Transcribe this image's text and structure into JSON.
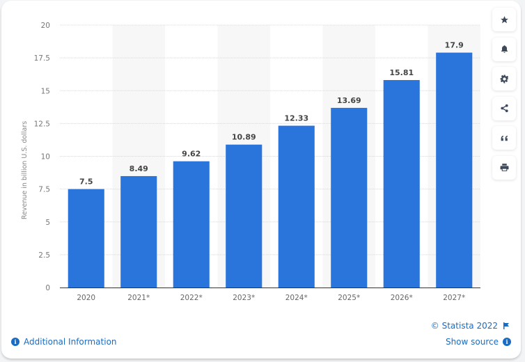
{
  "chart_data": {
    "type": "bar",
    "title": "",
    "xlabel": "",
    "ylabel": "Revenue in billion U.S. dollars",
    "categories": [
      "2020",
      "2021*",
      "2022*",
      "2023*",
      "2024*",
      "2025*",
      "2026*",
      "2027*"
    ],
    "values": [
      7.5,
      8.49,
      9.62,
      10.89,
      12.33,
      13.69,
      15.81,
      17.9
    ],
    "value_labels": [
      "7.5",
      "8.49",
      "9.62",
      "10.89",
      "12.33",
      "13.69",
      "15.81",
      "17.9"
    ],
    "ylim": [
      0,
      20
    ],
    "yticks": [
      0,
      2.5,
      5,
      7.5,
      10,
      12.5,
      15,
      17.5,
      20
    ],
    "ytick_labels": [
      "0",
      "2.5",
      "5",
      "7.5",
      "10",
      "12.5",
      "15",
      "17.5",
      "20"
    ],
    "grid": true,
    "legend": "none",
    "bar_color": "#2a75db"
  },
  "toolbar": {
    "items": [
      {
        "name": "star",
        "label": "Favorite"
      },
      {
        "name": "bell",
        "label": "Notifications"
      },
      {
        "name": "gear",
        "label": "Settings"
      },
      {
        "name": "share",
        "label": "Share"
      },
      {
        "name": "quote",
        "label": "Cite"
      },
      {
        "name": "print",
        "label": "Print"
      }
    ]
  },
  "footer": {
    "additional_info": "Additional Information",
    "copyright": "© Statista 2022",
    "show_source": "Show source",
    "info_glyph": "i"
  },
  "colors": {
    "link": "#1a6bc1",
    "bar": "#2a75db",
    "alt_column_bg": "#f7f7f7"
  }
}
